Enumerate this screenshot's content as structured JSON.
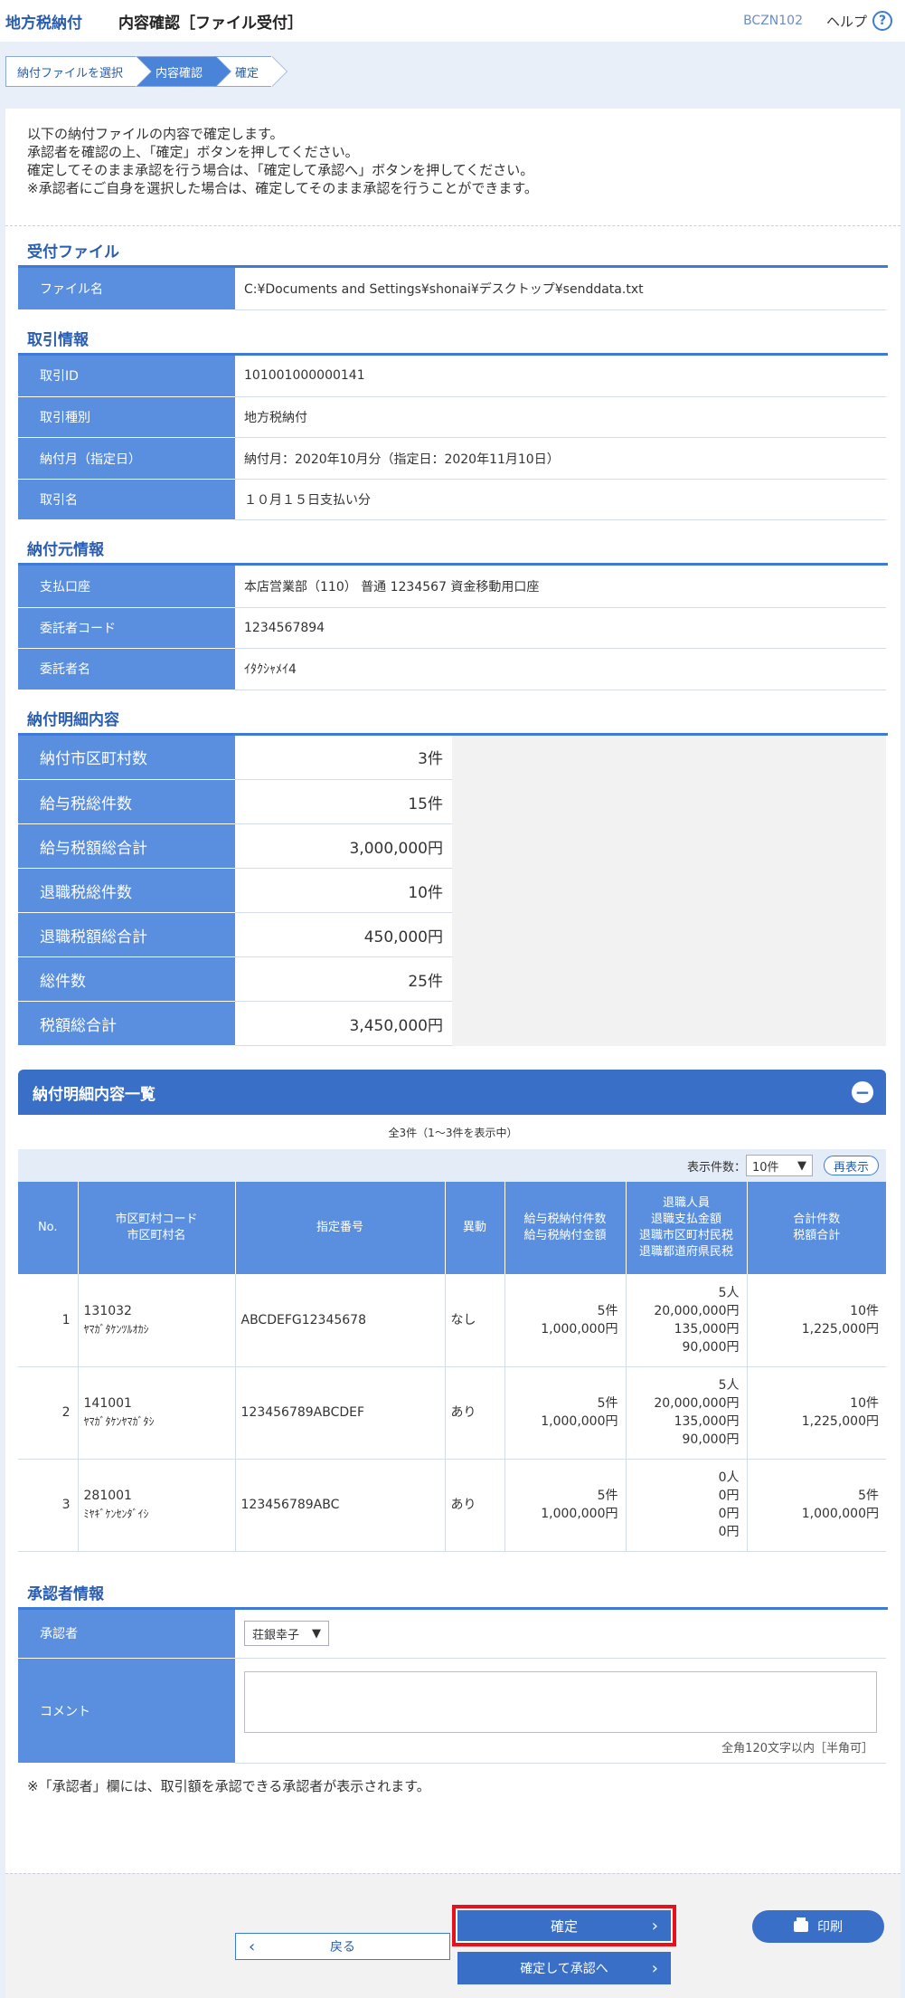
{
  "header": {
    "app_name": "地方税納付",
    "title": "内容確認［ファイル受付］",
    "screen_id": "BCZN102",
    "help_label": "ヘルプ",
    "help_icon": "?"
  },
  "steps": [
    "納付ファイルを選択",
    "内容確認",
    "確定"
  ],
  "intro": [
    "以下の納付ファイルの内容で確定します。",
    "承認者を確認の上、「確定」ボタンを押してください。",
    "確定してそのまま承認を行う場合は、「確定して承認へ」ボタンを押してください。",
    "※承認者にご自身を選択した場合は、確定してそのまま承認を行うことができます。"
  ],
  "received_file": {
    "title": "受付ファイル",
    "label": "ファイル名",
    "value": "C:¥Documents and Settings¥shonai¥デスクトップ¥senddata.txt"
  },
  "transaction": {
    "title": "取引情報",
    "rows": [
      {
        "label": "取引ID",
        "value": "101001000000141"
      },
      {
        "label": "取引種別",
        "value": "地方税納付"
      },
      {
        "label": "納付月（指定日）",
        "value": "納付月：2020年10月分（指定日：2020年11月10日）"
      },
      {
        "label": "取引名",
        "value": "１０月１５日支払い分"
      }
    ]
  },
  "payer": {
    "title": "納付元情報",
    "rows": [
      {
        "label": "支払口座",
        "value": "本店営業部（110） 普通 1234567 資金移動用口座"
      },
      {
        "label": "委託者コード",
        "value": "1234567894"
      },
      {
        "label": "委託者名",
        "value": "ｲﾀｸｼｬﾒｲ4"
      }
    ]
  },
  "summary": {
    "title": "納付明細内容",
    "rows": [
      {
        "label": "納付市区町村数",
        "value": "3件"
      },
      {
        "label": "給与税総件数",
        "value": "15件"
      },
      {
        "label": "給与税額総合計",
        "value": "3,000,000円"
      },
      {
        "label": "退職税総件数",
        "value": "10件"
      },
      {
        "label": "退職税額総合計",
        "value": "450,000円"
      },
      {
        "label": "総件数",
        "value": "25件"
      },
      {
        "label": "税額総合計",
        "value": "3,450,000円"
      }
    ]
  },
  "detail_list": {
    "title": "納付明細内容一覧",
    "collapse_icon": "−",
    "count_text": "全3件（1〜3件を表示中）",
    "display_count_label": "表示件数：",
    "display_count_value": "10件",
    "redisplay_label": "再表示",
    "headers": {
      "no": "No.",
      "city_line1": "市区町村コード",
      "city_line2": "市区町村名",
      "designation": "指定番号",
      "change": "異動",
      "salary_line1": "給与税納付件数",
      "salary_line2": "給与税納付金額",
      "retire_line1": "退職人員",
      "retire_line2": "退職支払金額",
      "retire_line3": "退職市区町村民税",
      "retire_line4": "退職都道府県民税",
      "total_line1": "合計件数",
      "total_line2": "税額合計"
    },
    "rows": [
      {
        "no": "1",
        "code": "131032",
        "name": "ﾔﾏｶﾞﾀｹﾝﾂﾙｵｶｼ",
        "designation": "ABCDEFG12345678",
        "change": "なし",
        "salary_count": "5件",
        "salary_amount": "1,000,000円",
        "retire_people": "5人",
        "retire_pay": "20,000,000円",
        "retire_city": "135,000円",
        "retire_pref": "90,000円",
        "total_count": "10件",
        "total_amount": "1,225,000円"
      },
      {
        "no": "2",
        "code": "141001",
        "name": "ﾔﾏｶﾞﾀｹﾝﾔﾏｶﾞﾀｼ",
        "designation": "123456789ABCDEF",
        "change": "あり",
        "salary_count": "5件",
        "salary_amount": "1,000,000円",
        "retire_people": "5人",
        "retire_pay": "20,000,000円",
        "retire_city": "135,000円",
        "retire_pref": "90,000円",
        "total_count": "10件",
        "total_amount": "1,225,000円"
      },
      {
        "no": "3",
        "code": "281001",
        "name": "ﾐﾔｷﾞｹﾝｾﾝﾀﾞｲｼ",
        "designation": "123456789ABC",
        "change": "あり",
        "salary_count": "5件",
        "salary_amount": "1,000,000円",
        "retire_people": "0人",
        "retire_pay": "0円",
        "retire_city": "0円",
        "retire_pref": "0円",
        "total_count": "5件",
        "total_amount": "1,000,000円"
      }
    ]
  },
  "approver": {
    "title": "承認者情報",
    "approver_label": "承認者",
    "approver_value": "荘銀幸子",
    "comment_label": "コメント",
    "comment_value": "",
    "char_limit": "全角120文字以内［半角可］",
    "note": "※「承認者」欄には、取引額を承認できる承認者が表示されます。"
  },
  "buttons": {
    "back": "戻る",
    "confirm": "確定",
    "confirm_approve": "確定して承認へ",
    "print": "印刷"
  }
}
